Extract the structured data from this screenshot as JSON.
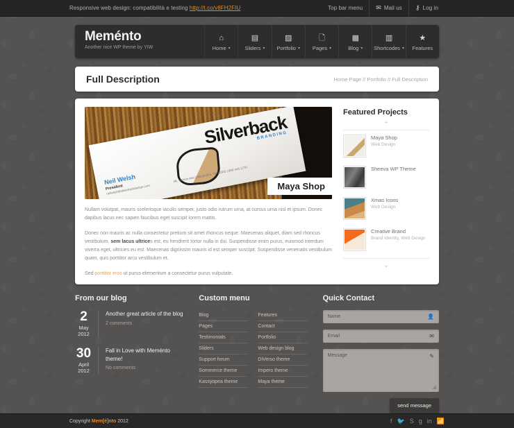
{
  "topbar": {
    "message": "Responsive web design: compatibilità e testing ",
    "link": "http://t.co/v8FH2FIU",
    "items": [
      {
        "label": "Top bar menu",
        "icon": ""
      },
      {
        "label": "Mail us",
        "icon": "✉"
      },
      {
        "label": "Log in",
        "icon": "⚷"
      }
    ]
  },
  "header": {
    "logo": "Meménto",
    "tagline": "Another nice WP theme by YIW",
    "nav": [
      {
        "label": "Home",
        "icon": "⌂",
        "caret": "▾"
      },
      {
        "label": "Sliders",
        "icon": "▤",
        "caret": "▾"
      },
      {
        "label": "Portfolio",
        "icon": "▨",
        "caret": "▾"
      },
      {
        "label": "Pages",
        "icon": "🗋",
        "caret": "▾"
      },
      {
        "label": "Blog",
        "icon": "▦",
        "caret": "▾"
      },
      {
        "label": "Shortcodes",
        "icon": "▥",
        "caret": "▾"
      },
      {
        "label": "Features",
        "icon": "★",
        "caret": ""
      }
    ]
  },
  "titlebar": {
    "title": "Full Description",
    "breadcrumb": "Home Page // Portfolio // Full Description"
  },
  "hero": {
    "label": "Maya Shop",
    "card": {
      "brand": "Silverback",
      "sub": "BRANDING",
      "name": "Neil Welsh",
      "role": "President",
      "email": "neilwlsh@silverbackdesign.com",
      "address": "Mt. Vernon Ave  |  Alexandria, VA 22305  |  800.444.1770"
    }
  },
  "body": {
    "p1": "Nullam volutpat, mauris scelerisque iaculis semper, justo odio rutrum urna, at cursus urna nisl et ipsum. Donec dapibus lacus nec sapien faucibus eget suscipit lorem mattis.",
    "p2_a": "Donec non mauris ac nulla consectetur pretium sit amet rhoncus neque. Maecenas aliquet, diam sed rhoncus vestibulum, ",
    "p2_b": "sem lacus ultrice",
    "p2_c": "s est, eu hendrerit tortor nulla in dui. Suspendisse enim purus, euismod interdum viverra eget, ultricies eu est. Maecenas dignissim mauris id est semper suscipit. Suspendisse venenatis vestibulum quam, quis porttitor arcu vestibulum et.",
    "p3_a": "Sed ",
    "p3_link": "porttitor eros",
    "p3_b": " ut purus elementum a consectetur purus vulputate."
  },
  "featured": {
    "title": "Featured Projects",
    "arrow_up": "⌃",
    "arrow_down": "⌄",
    "projects": [
      {
        "name": "Maya Shop",
        "category": "Web Design"
      },
      {
        "name": "Sheeva WP Theme",
        "category": ""
      },
      {
        "name": "Xmas Icons",
        "category": "Web Design"
      },
      {
        "name": "Creative Brand",
        "category": "Brand Identity, Web Design"
      }
    ]
  },
  "blog": {
    "title": "From our blog",
    "posts": [
      {
        "day": "2",
        "month": "May",
        "year": "2012",
        "title": "Another great article of the blog",
        "meta": "2 comments"
      },
      {
        "day": "30",
        "month": "April",
        "year": "2012",
        "title": "Fall in Love with Meménto theme!",
        "meta": "No comments"
      }
    ]
  },
  "custom_menu": {
    "title": "Custom menu",
    "col1": [
      "Blog",
      "Pages",
      "Testimonials",
      "Sliders",
      "Support forum",
      "Sommerce theme",
      "Kassyopea theme"
    ],
    "col2": [
      "Features",
      "Contact",
      "Portfolio",
      "Web design blog",
      "DiVerso theme",
      "Impero theme",
      "Maya theme"
    ]
  },
  "contact": {
    "title": "Quick Contact",
    "name_placeholder": "Name",
    "name_icon": "👤",
    "email_placeholder": "Email",
    "email_icon": "✉",
    "message_placeholder": "Message",
    "message_icon": "✎",
    "grip": "◢",
    "send_label": "send message"
  },
  "footer": {
    "copyright_prefix": "Copyright ",
    "copyright_brand": "Mem[é]nto",
    "copyright_year": " 2012",
    "socials": [
      "f",
      "🐦",
      "S",
      "g",
      "in",
      "📶"
    ]
  },
  "colors": {
    "accent": "#e08a2e",
    "link": "#e8a149",
    "dark": "#2d2d2d"
  }
}
